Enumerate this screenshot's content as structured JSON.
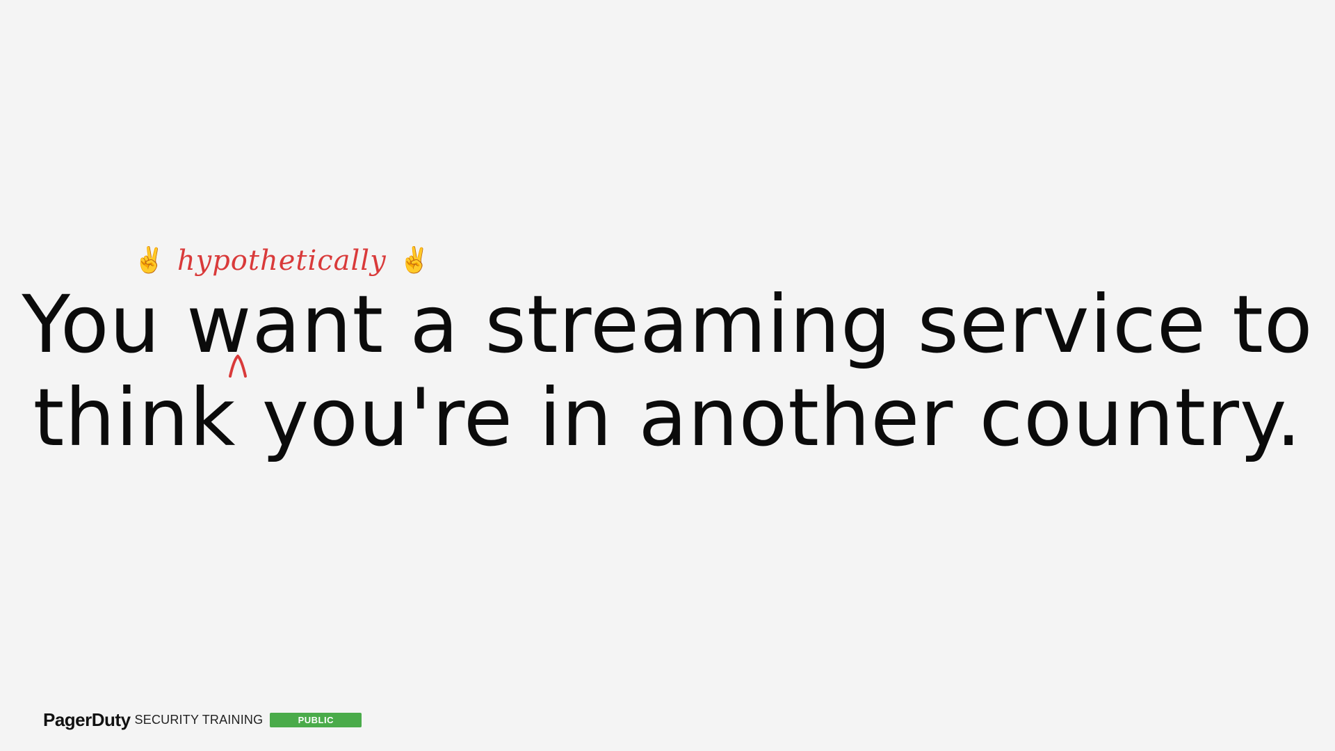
{
  "annotation": {
    "left_emoji": "✌️",
    "text": "hypothetically",
    "right_emoji": "✌️",
    "left_emoji_icon": "victory-hand-icon",
    "right_emoji_icon": "victory-hand-icon",
    "color": "#d93a3a"
  },
  "headline": {
    "line1": "You want a streaming service to",
    "line2": "think you're in another country."
  },
  "insertion_mark": {
    "icon": "caret-insert-icon",
    "color": "#d93a3a"
  },
  "footer": {
    "logo": "PagerDuty",
    "label": "SECURITY TRAINING",
    "badge": "PUBLIC",
    "badge_color": "#4aab4a"
  },
  "colors": {
    "background": "#f4f4f4",
    "text": "#0b0b0b"
  }
}
